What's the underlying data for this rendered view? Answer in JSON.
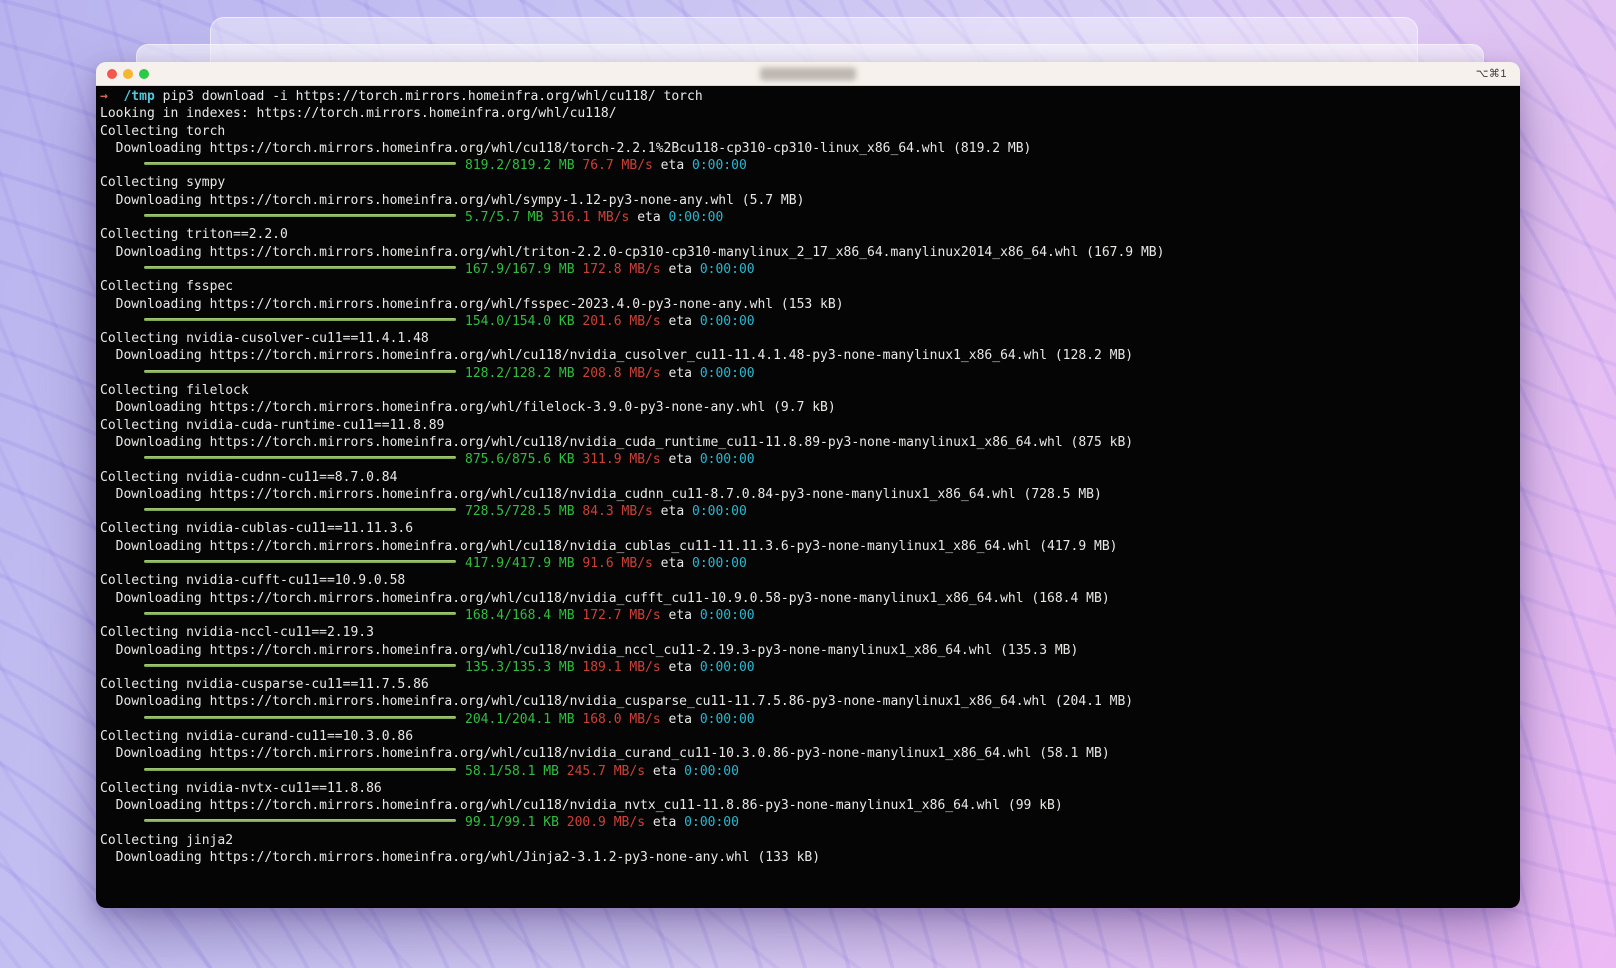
{
  "window": {
    "shortcut_badge": "⌥⌘1",
    "traffic_lights": [
      "close",
      "minimize",
      "zoom"
    ],
    "title": ""
  },
  "palette": {
    "fg": "#e9e8e6",
    "green": "#2fbf3f",
    "speed_red": "#cc4137",
    "eta_cyan": "#24b9d1",
    "bar_green": "#8bb35c",
    "prompt_arrow": "#d9655a",
    "prompt_path": "#50c8dc",
    "terminal_bg": "#050505",
    "titlebar_bg": "#f6f1ec"
  },
  "terminal": {
    "labels": {
      "eta": "eta"
    },
    "lines": [
      {
        "type": "cmd",
        "segments": [
          {
            "text": "→  ",
            "cls": "c-arrow"
          },
          {
            "text": "/tmp ",
            "cls": "c-path"
          },
          {
            "text": "pip3 download -i https://torch.mirrors.homeinfra.org/whl/cu118/ torch",
            "cls": ""
          }
        ]
      },
      {
        "type": "text",
        "text": "Looking in indexes: https://torch.mirrors.homeinfra.org/whl/cu118/"
      },
      {
        "type": "text",
        "text": "Collecting torch"
      },
      {
        "type": "text",
        "text": "  Downloading https://torch.mirrors.homeinfra.org/whl/cu118/torch-2.2.1%2Bcu118-cp310-cp310-linux_x86_64.whl (819.2 MB)"
      },
      {
        "type": "progress",
        "done": "819.2/819.2 MB",
        "speed": "76.7 MB/s",
        "eta": "0:00:00"
      },
      {
        "type": "text",
        "text": "Collecting sympy"
      },
      {
        "type": "text",
        "text": "  Downloading https://torch.mirrors.homeinfra.org/whl/sympy-1.12-py3-none-any.whl (5.7 MB)"
      },
      {
        "type": "progress",
        "done": "5.7/5.7 MB",
        "speed": "316.1 MB/s",
        "eta": "0:00:00"
      },
      {
        "type": "text",
        "text": "Collecting triton==2.2.0"
      },
      {
        "type": "text",
        "text": "  Downloading https://torch.mirrors.homeinfra.org/whl/triton-2.2.0-cp310-cp310-manylinux_2_17_x86_64.manylinux2014_x86_64.whl (167.9 MB)"
      },
      {
        "type": "progress",
        "done": "167.9/167.9 MB",
        "speed": "172.8 MB/s",
        "eta": "0:00:00"
      },
      {
        "type": "text",
        "text": "Collecting fsspec"
      },
      {
        "type": "text",
        "text": "  Downloading https://torch.mirrors.homeinfra.org/whl/fsspec-2023.4.0-py3-none-any.whl (153 kB)"
      },
      {
        "type": "progress",
        "done": "154.0/154.0 KB",
        "speed": "201.6 MB/s",
        "eta": "0:00:00"
      },
      {
        "type": "text",
        "text": "Collecting nvidia-cusolver-cu11==11.4.1.48"
      },
      {
        "type": "text",
        "text": "  Downloading https://torch.mirrors.homeinfra.org/whl/cu118/nvidia_cusolver_cu11-11.4.1.48-py3-none-manylinux1_x86_64.whl (128.2 MB)"
      },
      {
        "type": "progress",
        "done": "128.2/128.2 MB",
        "speed": "208.8 MB/s",
        "eta": "0:00:00"
      },
      {
        "type": "text",
        "text": "Collecting filelock"
      },
      {
        "type": "text",
        "text": "  Downloading https://torch.mirrors.homeinfra.org/whl/filelock-3.9.0-py3-none-any.whl (9.7 kB)"
      },
      {
        "type": "text",
        "text": "Collecting nvidia-cuda-runtime-cu11==11.8.89"
      },
      {
        "type": "text",
        "text": "  Downloading https://torch.mirrors.homeinfra.org/whl/cu118/nvidia_cuda_runtime_cu11-11.8.89-py3-none-manylinux1_x86_64.whl (875 kB)"
      },
      {
        "type": "progress",
        "done": "875.6/875.6 KB",
        "speed": "311.9 MB/s",
        "eta": "0:00:00"
      },
      {
        "type": "text",
        "text": "Collecting nvidia-cudnn-cu11==8.7.0.84"
      },
      {
        "type": "text",
        "text": "  Downloading https://torch.mirrors.homeinfra.org/whl/cu118/nvidia_cudnn_cu11-8.7.0.84-py3-none-manylinux1_x86_64.whl (728.5 MB)"
      },
      {
        "type": "progress",
        "done": "728.5/728.5 MB",
        "speed": "84.3 MB/s",
        "eta": "0:00:00"
      },
      {
        "type": "text",
        "text": "Collecting nvidia-cublas-cu11==11.11.3.6"
      },
      {
        "type": "text",
        "text": "  Downloading https://torch.mirrors.homeinfra.org/whl/cu118/nvidia_cublas_cu11-11.11.3.6-py3-none-manylinux1_x86_64.whl (417.9 MB)"
      },
      {
        "type": "progress",
        "done": "417.9/417.9 MB",
        "speed": "91.6 MB/s",
        "eta": "0:00:00"
      },
      {
        "type": "text",
        "text": "Collecting nvidia-cufft-cu11==10.9.0.58"
      },
      {
        "type": "text",
        "text": "  Downloading https://torch.mirrors.homeinfra.org/whl/cu118/nvidia_cufft_cu11-10.9.0.58-py3-none-manylinux1_x86_64.whl (168.4 MB)"
      },
      {
        "type": "progress",
        "done": "168.4/168.4 MB",
        "speed": "172.7 MB/s",
        "eta": "0:00:00"
      },
      {
        "type": "text",
        "text": "Collecting nvidia-nccl-cu11==2.19.3"
      },
      {
        "type": "text",
        "text": "  Downloading https://torch.mirrors.homeinfra.org/whl/cu118/nvidia_nccl_cu11-2.19.3-py3-none-manylinux1_x86_64.whl (135.3 MB)"
      },
      {
        "type": "progress",
        "done": "135.3/135.3 MB",
        "speed": "189.1 MB/s",
        "eta": "0:00:00"
      },
      {
        "type": "text",
        "text": "Collecting nvidia-cusparse-cu11==11.7.5.86"
      },
      {
        "type": "text",
        "text": "  Downloading https://torch.mirrors.homeinfra.org/whl/cu118/nvidia_cusparse_cu11-11.7.5.86-py3-none-manylinux1_x86_64.whl (204.1 MB)"
      },
      {
        "type": "progress",
        "done": "204.1/204.1 MB",
        "speed": "168.0 MB/s",
        "eta": "0:00:00"
      },
      {
        "type": "text",
        "text": "Collecting nvidia-curand-cu11==10.3.0.86"
      },
      {
        "type": "text",
        "text": "  Downloading https://torch.mirrors.homeinfra.org/whl/cu118/nvidia_curand_cu11-10.3.0.86-py3-none-manylinux1_x86_64.whl (58.1 MB)"
      },
      {
        "type": "progress",
        "done": "58.1/58.1 MB",
        "speed": "245.7 MB/s",
        "eta": "0:00:00"
      },
      {
        "type": "text",
        "text": "Collecting nvidia-nvtx-cu11==11.8.86"
      },
      {
        "type": "text",
        "text": "  Downloading https://torch.mirrors.homeinfra.org/whl/cu118/nvidia_nvtx_cu11-11.8.86-py3-none-manylinux1_x86_64.whl (99 kB)"
      },
      {
        "type": "progress",
        "done": "99.1/99.1 KB",
        "speed": "200.9 MB/s",
        "eta": "0:00:00"
      },
      {
        "type": "text",
        "text": "Collecting jinja2"
      },
      {
        "type": "text",
        "text": "  Downloading https://torch.mirrors.homeinfra.org/whl/Jinja2-3.1.2-py3-none-any.whl (133 kB)"
      }
    ]
  }
}
